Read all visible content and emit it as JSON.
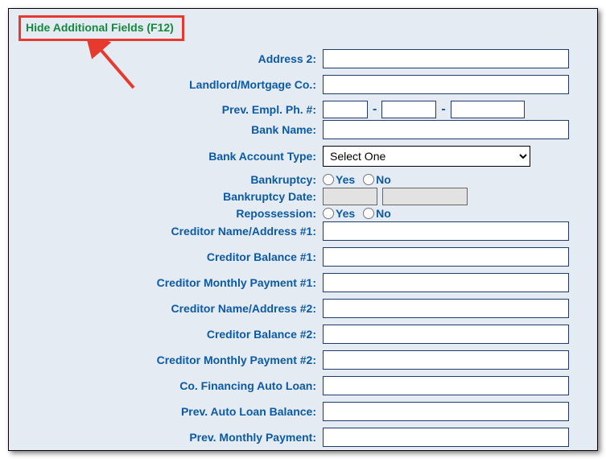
{
  "toggle": {
    "label": "Hide Additional Fields (F12)"
  },
  "labels": {
    "address2": "Address 2:",
    "landlord": "Landlord/Mortgage Co.:",
    "prevEmplPh": "Prev. Empl. Ph. #:",
    "bankName": "Bank Name:",
    "bankAcctType": "Bank Account Type:",
    "bankruptcy": "Bankruptcy:",
    "bankruptcyDate": "Bankruptcy Date:",
    "repossession": "Repossession:",
    "creditor1": "Creditor Name/Address #1:",
    "creditorBal1": "Creditor Balance #1:",
    "creditorPay1": "Creditor Monthly Payment #1:",
    "creditor2": "Creditor Name/Address #2:",
    "creditorBal2": "Creditor Balance #2:",
    "creditorPay2": "Creditor Monthly Payment #2:",
    "coFinancing": "Co. Financing Auto Loan:",
    "prevLoanBal": "Prev. Auto Loan Balance:",
    "prevMonthlyPay": "Prev. Monthly Payment:"
  },
  "radio": {
    "yes": "Yes",
    "no": "No"
  },
  "select": {
    "placeholder": "Select One"
  },
  "dash": "-"
}
